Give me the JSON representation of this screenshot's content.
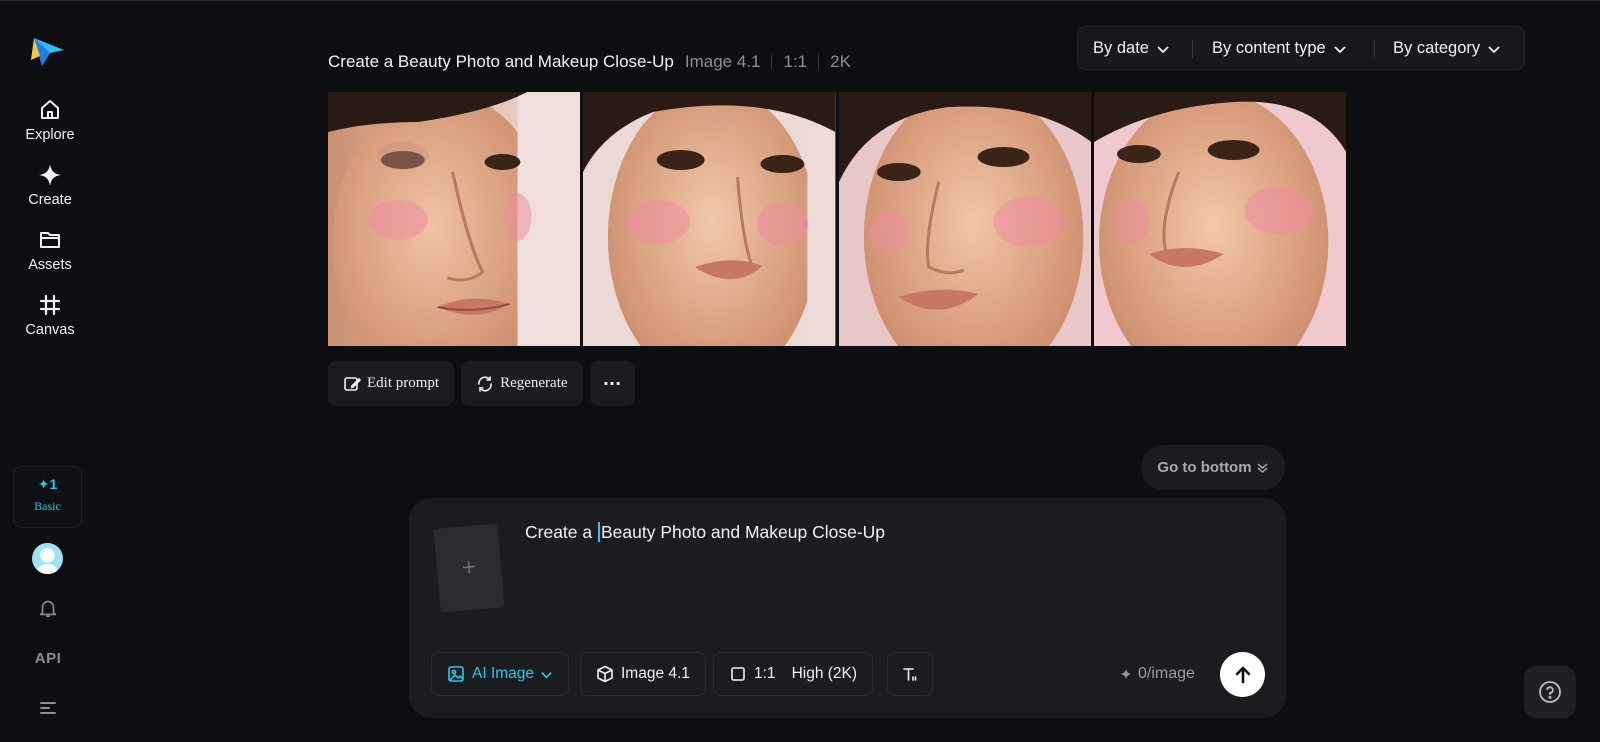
{
  "nav": {
    "items": [
      {
        "label": "Explore",
        "icon": "home-icon"
      },
      {
        "label": "Create",
        "icon": "sparkle-icon"
      },
      {
        "label": "Assets",
        "icon": "folder-icon"
      },
      {
        "label": "Canvas",
        "icon": "grid-hash-icon"
      }
    ],
    "plan": {
      "credits": "✦1",
      "tier": "Basic"
    },
    "api_label": "API"
  },
  "filters": {
    "by_date": "By date",
    "by_content_type": "By content type",
    "by_category": "By category"
  },
  "result": {
    "title": "Create a Beauty Photo and Makeup Close-Up",
    "model": "Image 4.1",
    "ratio": "1:1",
    "resolution": "2K",
    "images": [
      {
        "alt": "beauty close-up variant 1"
      },
      {
        "alt": "beauty close-up variant 2"
      },
      {
        "alt": "beauty close-up variant 3"
      },
      {
        "alt": "beauty close-up variant 4"
      }
    ],
    "actions": {
      "edit": "Edit prompt",
      "regenerate": "Regenerate",
      "more": "···"
    }
  },
  "go_to_bottom": "Go to bottom",
  "composer": {
    "prompt_before_caret": "Create a ",
    "prompt_after_caret": "Beauty Photo and Makeup Close-Up",
    "ref_plus": "+",
    "mode": "AI Image",
    "model": "Image 4.1",
    "ratio": "1:1",
    "quality": "High (2K)",
    "cost": "0/image"
  },
  "colors": {
    "accent": "#2ec6e8",
    "background": "#0d0e11",
    "panel": "#1b1c20"
  }
}
